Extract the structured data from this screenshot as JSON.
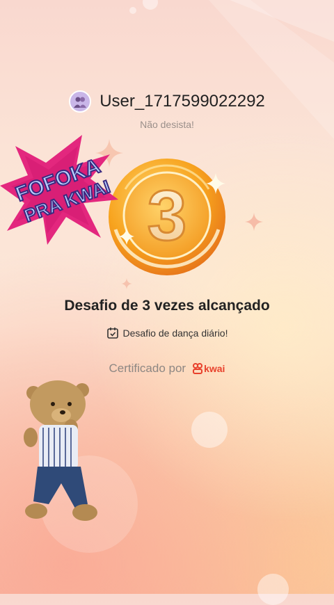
{
  "header": {
    "username": "User_1717599022292",
    "subtitle": "Não desista!"
  },
  "badge": {
    "number": "3"
  },
  "achievement": {
    "headline": "Desafio de 3 vezes alcançado",
    "challenge_label": "Desafio de dança diário!",
    "certified_by": "Certificado por",
    "brand": "kwai"
  },
  "sticker": {
    "line1": "FOFOKA",
    "line2": "PRA KWAI"
  },
  "icons": [
    "avatar-icon",
    "calendar-check-icon",
    "kwai-logo-icon",
    "sparkle-icon",
    "teddy-bear-icon"
  ]
}
